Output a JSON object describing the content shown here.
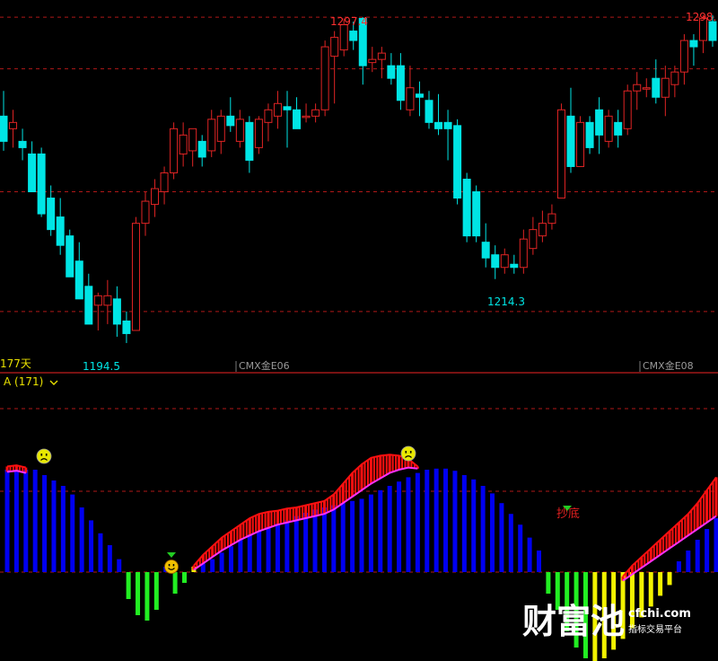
{
  "colors": {
    "background": "#000000",
    "up_candle": "#e02424",
    "down_candle": "#00e5e5",
    "grid": "#b01818",
    "divider": "#c01c1c",
    "separator": "#666666",
    "label_red": "#ff3030",
    "label_cyan": "#00e5e5",
    "label_yellow": "#e8e000",
    "bar_blue": "#0000f0",
    "bar_green": "#22ee22",
    "bar_yellow": "#f2f200",
    "band_red": "#ff1010",
    "line_magenta": "#ff30ff",
    "watermark": "#ffffff"
  },
  "price_panel": {
    "period_label": "177天",
    "contract_labels": [
      "CMX金E06",
      "CMX金E08"
    ],
    "high_label": "1297.4",
    "high_label_right": "1298.",
    "low_label_left": "1194.5",
    "low_label_mid": "1214.3"
  },
  "indicator_panel": {
    "header": "A (171)",
    "signal_label": "抄底"
  },
  "watermark": {
    "brand": "财富池",
    "domain": "cfchi.com",
    "tagline": "指标交易平台"
  },
  "chart_data": [
    {
      "type": "candlestick",
      "ylim": [
        1190,
        1300
      ],
      "gridlines": [
        1204,
        1242,
        1281,
        1297.4
      ],
      "annotations": [
        "1297.4",
        "1298.",
        "1194.5",
        "1214.3"
      ],
      "candles": [
        [
          1266,
          1274,
          1255,
          1258
        ],
        [
          1262,
          1268,
          1256,
          1264
        ],
        [
          1258,
          1262,
          1252,
          1256
        ],
        [
          1254,
          1258,
          1242,
          1242
        ],
        [
          1254,
          1256,
          1234,
          1235
        ],
        [
          1240,
          1244,
          1228,
          1230
        ],
        [
          1234,
          1240,
          1222,
          1225
        ],
        [
          1228,
          1230,
          1215,
          1215
        ],
        [
          1220,
          1226,
          1208,
          1208
        ],
        [
          1212,
          1216,
          1200,
          1200
        ],
        [
          1206,
          1210,
          1198,
          1209
        ],
        [
          1206,
          1214,
          1200,
          1209
        ],
        [
          1208,
          1212,
          1196,
          1200
        ],
        [
          1201,
          1204,
          1194,
          1197
        ],
        [
          1198,
          1234,
          1198,
          1232
        ],
        [
          1232,
          1242,
          1228,
          1239
        ],
        [
          1238,
          1246,
          1234,
          1243
        ],
        [
          1242,
          1250,
          1238,
          1248
        ],
        [
          1248,
          1264,
          1246,
          1262
        ],
        [
          1254,
          1264,
          1250,
          1260
        ],
        [
          1255,
          1262,
          1250,
          1262
        ],
        [
          1258,
          1260,
          1250,
          1253
        ],
        [
          1255,
          1268,
          1253,
          1265
        ],
        [
          1258,
          1268,
          1254,
          1266
        ],
        [
          1266,
          1272,
          1261,
          1263
        ],
        [
          1258,
          1268,
          1256,
          1265
        ],
        [
          1264,
          1266,
          1248,
          1252
        ],
        [
          1256,
          1266,
          1254,
          1265
        ],
        [
          1264,
          1270,
          1258,
          1268
        ],
        [
          1266,
          1274,
          1262,
          1270
        ],
        [
          1269,
          1274,
          1256,
          1268
        ],
        [
          1268,
          1272,
          1262,
          1262
        ],
        [
          1266,
          1270,
          1264,
          1266
        ],
        [
          1266,
          1270,
          1264,
          1268
        ],
        [
          1268,
          1290,
          1266,
          1288
        ],
        [
          1285,
          1293,
          1270,
          1291
        ],
        [
          1287,
          1297,
          1285,
          1295
        ],
        [
          1293,
          1296,
          1287,
          1290
        ],
        [
          1297,
          1297.4,
          1276,
          1282
        ],
        [
          1283,
          1288,
          1280,
          1284
        ],
        [
          1284,
          1288,
          1278,
          1286
        ],
        [
          1282,
          1286,
          1276,
          1278
        ],
        [
          1282,
          1286,
          1268,
          1271
        ],
        [
          1268,
          1282,
          1266,
          1275
        ],
        [
          1273,
          1277,
          1266,
          1272
        ],
        [
          1271,
          1274,
          1262,
          1264
        ],
        [
          1264,
          1273,
          1260,
          1262
        ],
        [
          1264,
          1268,
          1252,
          1262
        ],
        [
          1263,
          1265,
          1238,
          1240
        ],
        [
          1246,
          1248,
          1226,
          1228
        ],
        [
          1242,
          1244,
          1226,
          1228
        ],
        [
          1226,
          1232,
          1218,
          1221
        ],
        [
          1222,
          1225,
          1214.3,
          1218
        ],
        [
          1218,
          1224,
          1216,
          1222
        ],
        [
          1219,
          1222,
          1216,
          1218
        ],
        [
          1218,
          1230,
          1216,
          1227
        ],
        [
          1224,
          1234,
          1222,
          1230
        ],
        [
          1228,
          1236,
          1226,
          1232
        ],
        [
          1232,
          1238,
          1230,
          1235
        ],
        [
          1240,
          1270,
          1240,
          1268
        ],
        [
          1266,
          1275,
          1248,
          1250
        ],
        [
          1250,
          1266,
          1250,
          1264
        ],
        [
          1264,
          1266,
          1254,
          1256
        ],
        [
          1268,
          1272,
          1254,
          1260
        ],
        [
          1258,
          1268,
          1256,
          1266
        ],
        [
          1264,
          1268,
          1256,
          1260
        ],
        [
          1262,
          1276,
          1260,
          1274
        ],
        [
          1274,
          1280,
          1268,
          1276
        ],
        [
          1275,
          1278,
          1272,
          1275
        ],
        [
          1278,
          1284,
          1270,
          1272
        ],
        [
          1272,
          1282,
          1266,
          1278
        ],
        [
          1276,
          1282,
          1272,
          1280
        ],
        [
          1280,
          1292,
          1276,
          1290
        ],
        [
          1290,
          1292,
          1282,
          1288
        ],
        [
          1290,
          1298,
          1286,
          1297
        ],
        [
          1296,
          1298,
          1288,
          1290
        ]
      ]
    },
    {
      "type": "bar",
      "base": 0,
      "bars": [
        [
          0.95,
          "blue"
        ],
        [
          0.95,
          "blue"
        ],
        [
          0.95,
          "blue"
        ],
        [
          0.95,
          "blue"
        ],
        [
          0.9,
          "blue"
        ],
        [
          0.85,
          "blue"
        ],
        [
          0.8,
          "blue"
        ],
        [
          0.72,
          "blue"
        ],
        [
          0.6,
          "blue"
        ],
        [
          0.48,
          "blue"
        ],
        [
          0.36,
          "blue"
        ],
        [
          0.25,
          "blue"
        ],
        [
          0.12,
          "blue"
        ],
        [
          -0.25,
          "green"
        ],
        [
          -0.4,
          "green"
        ],
        [
          -0.45,
          "green"
        ],
        [
          -0.35,
          "green"
        ],
        [
          0.05,
          "blue"
        ],
        [
          -0.2,
          "green"
        ],
        [
          -0.1,
          "green"
        ],
        [
          0.05,
          "yellow"
        ],
        [
          0.08,
          "blue"
        ],
        [
          0.12,
          "blue"
        ],
        [
          0.18,
          "blue"
        ],
        [
          0.24,
          "blue"
        ],
        [
          0.3,
          "blue"
        ],
        [
          0.35,
          "blue"
        ],
        [
          0.38,
          "blue"
        ],
        [
          0.42,
          "blue"
        ],
        [
          0.45,
          "blue"
        ],
        [
          0.48,
          "blue"
        ],
        [
          0.52,
          "blue"
        ],
        [
          0.55,
          "blue"
        ],
        [
          0.58,
          "blue"
        ],
        [
          0.6,
          "blue"
        ],
        [
          0.62,
          "blue"
        ],
        [
          0.64,
          "blue"
        ],
        [
          0.66,
          "blue"
        ],
        [
          0.68,
          "blue"
        ],
        [
          0.72,
          "blue"
        ],
        [
          0.76,
          "blue"
        ],
        [
          0.8,
          "blue"
        ],
        [
          0.84,
          "blue"
        ],
        [
          0.88,
          "blue"
        ],
        [
          0.92,
          "blue"
        ],
        [
          0.95,
          "blue"
        ],
        [
          0.96,
          "blue"
        ],
        [
          0.96,
          "blue"
        ],
        [
          0.94,
          "blue"
        ],
        [
          0.9,
          "blue"
        ],
        [
          0.86,
          "blue"
        ],
        [
          0.8,
          "blue"
        ],
        [
          0.73,
          "blue"
        ],
        [
          0.64,
          "blue"
        ],
        [
          0.54,
          "blue"
        ],
        [
          0.44,
          "blue"
        ],
        [
          0.32,
          "blue"
        ],
        [
          0.2,
          "blue"
        ],
        [
          -0.2,
          "green"
        ],
        [
          -0.35,
          "green"
        ],
        [
          -0.55,
          "green"
        ],
        [
          -0.7,
          "green"
        ],
        [
          -0.8,
          "green"
        ],
        [
          -0.85,
          "yellow"
        ],
        [
          -0.8,
          "yellow"
        ],
        [
          -0.72,
          "yellow"
        ],
        [
          -0.62,
          "yellow"
        ],
        [
          -0.52,
          "yellow"
        ],
        [
          -0.42,
          "yellow"
        ],
        [
          -0.32,
          "yellow"
        ],
        [
          -0.22,
          "yellow"
        ],
        [
          -0.12,
          "yellow"
        ],
        [
          0.1,
          "blue"
        ],
        [
          0.2,
          "blue"
        ],
        [
          0.3,
          "blue"
        ],
        [
          0.4,
          "blue"
        ],
        [
          0.5,
          "blue"
        ]
      ],
      "band_upper": [
        0.98,
        0.99,
        0.97,
        null,
        null,
        null,
        null,
        null,
        null,
        null,
        null,
        null,
        null,
        null,
        null,
        null,
        null,
        null,
        null,
        null,
        0.06,
        0.16,
        0.24,
        0.32,
        0.38,
        0.44,
        0.5,
        0.54,
        0.56,
        0.57,
        0.59,
        0.6,
        0.62,
        0.64,
        0.66,
        0.72,
        0.82,
        0.92,
        1.0,
        1.06,
        1.08,
        1.09,
        1.08,
        1.05,
        0.98,
        null,
        null,
        null,
        null,
        null,
        null,
        null,
        null,
        null,
        null,
        null,
        null,
        null,
        null,
        null,
        null,
        null,
        null,
        null,
        null,
        null,
        -0.04,
        0.06,
        0.14,
        0.22,
        0.3,
        0.38,
        0.46,
        0.54,
        0.64,
        0.76,
        0.88
      ],
      "band_lower": [
        0.93,
        0.94,
        0.92,
        null,
        null,
        null,
        null,
        null,
        null,
        null,
        null,
        null,
        null,
        null,
        null,
        null,
        null,
        null,
        null,
        null,
        0.02,
        0.08,
        0.14,
        0.2,
        0.25,
        0.3,
        0.34,
        0.38,
        0.41,
        0.44,
        0.46,
        0.48,
        0.5,
        0.52,
        0.54,
        0.58,
        0.64,
        0.7,
        0.76,
        0.82,
        0.87,
        0.92,
        0.95,
        0.97,
        0.96,
        null,
        null,
        null,
        null,
        null,
        null,
        null,
        null,
        null,
        null,
        null,
        null,
        null,
        null,
        null,
        null,
        null,
        null,
        null,
        null,
        null,
        -0.08,
        -0.02,
        0.04,
        0.1,
        0.16,
        0.22,
        0.28,
        0.34,
        0.4,
        0.46,
        0.52
      ]
    }
  ]
}
